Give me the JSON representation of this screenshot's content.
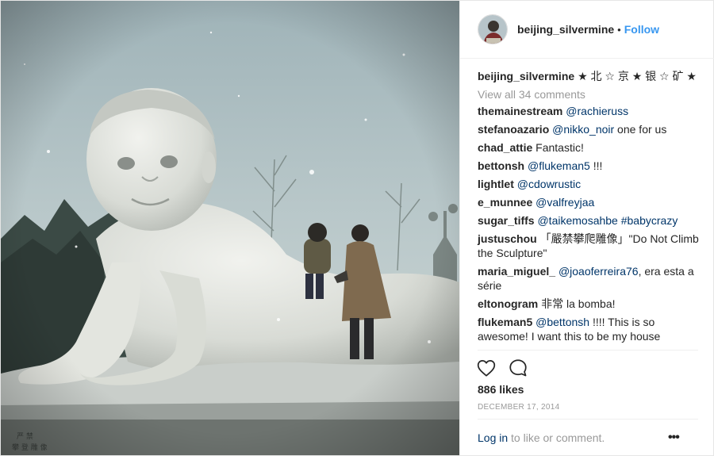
{
  "header": {
    "username": "beijing_silvermine",
    "separator": "•",
    "follow_label": "Follow",
    "avatar_icon": "profile-avatar"
  },
  "caption": {
    "username": "beijing_silvermine",
    "text": "★ 北 ☆ 京 ★ 银 ☆ 矿 ★"
  },
  "view_all_comments": "View all 34 comments",
  "comments": [
    {
      "user": "themainestream",
      "mention": "@rachieruss",
      "text": ""
    },
    {
      "user": "stefanoazario",
      "mention": "@nikko_noir",
      "text": " one for us"
    },
    {
      "user": "chad_attie",
      "mention": "",
      "text": "Fantastic!"
    },
    {
      "user": "bettonsh",
      "mention": "@flukeman5",
      "text": " !!!"
    },
    {
      "user": "lightlet",
      "mention": "@cdowrustic",
      "text": ""
    },
    {
      "user": "e_munnee",
      "mention": "@valfreyjaa",
      "text": ""
    },
    {
      "user": "sugar_tiffs",
      "mention": "@taikemosahbe #babycrazy",
      "text": ""
    },
    {
      "user": "justuschou",
      "mention": "",
      "text": "「嚴禁攀爬雕像」\"Do Not Climb the Sculpture\""
    },
    {
      "user": "maria_miguel_",
      "mention": "@joaoferreira76",
      "text": ", era esta a série"
    },
    {
      "user": "eltonogram",
      "mention": "",
      "text": "非常 la bomba!"
    },
    {
      "user": "flukeman5",
      "mention": "@bettonsh",
      "text": " !!!! This is so awesome! I want this to be my house"
    }
  ],
  "actions": {
    "like_icon": "heart-icon",
    "comment_icon": "comment-bubble-icon"
  },
  "likes": "886 likes",
  "date": "DECEMBER 17, 2014",
  "footer": {
    "login_label": "Log in",
    "login_suffix": " to like or comment.",
    "more_label": "•••"
  },
  "colors": {
    "link_blue": "#3897f0",
    "mention": "#003569",
    "muted": "#999999",
    "text": "#262626"
  }
}
